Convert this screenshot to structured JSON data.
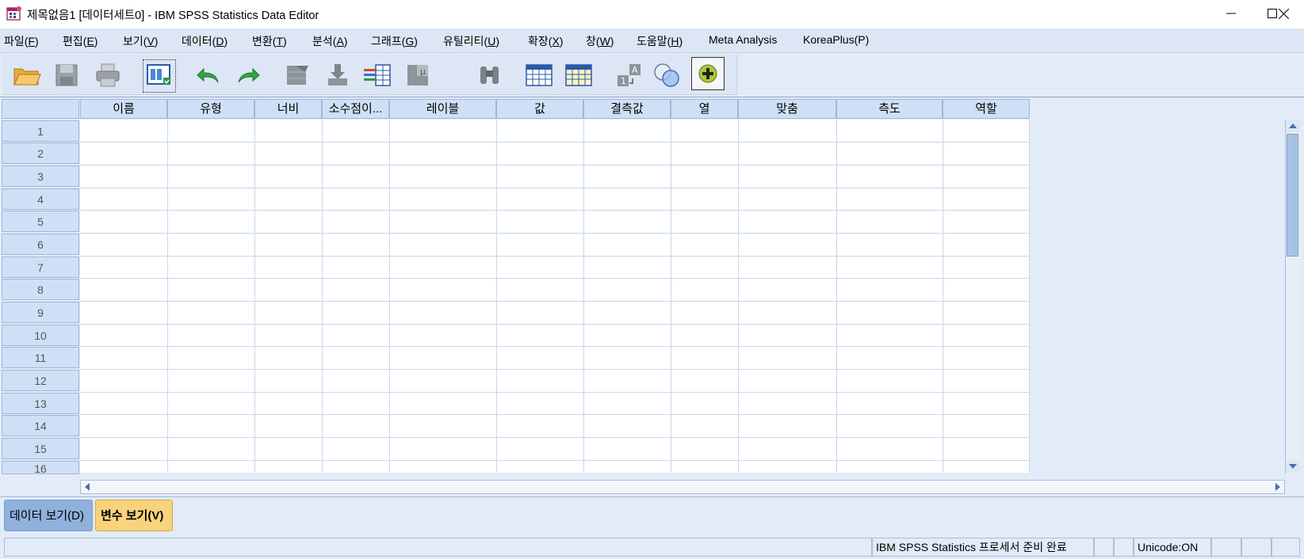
{
  "window": {
    "title": "제목없음1 [데이터세트0] - IBM SPSS Statistics Data Editor"
  },
  "menu": [
    {
      "label": "파일",
      "key": "F"
    },
    {
      "label": "편집",
      "key": "E"
    },
    {
      "label": "보기",
      "key": "V"
    },
    {
      "label": "데이터",
      "key": "D"
    },
    {
      "label": "변환",
      "key": "T"
    },
    {
      "label": "분석",
      "key": "A"
    },
    {
      "label": "그래프",
      "key": "G"
    },
    {
      "label": "유틸리티",
      "key": "U"
    },
    {
      "label": "확장",
      "key": "X"
    },
    {
      "label": "창",
      "key": "W"
    },
    {
      "label": "도움말",
      "key": "H"
    },
    {
      "label": "Meta Analysis",
      "key": ""
    },
    {
      "label": "KoreaPlus(P)",
      "key": ""
    }
  ],
  "toolbar": {
    "icons": [
      "open-folder-icon",
      "save-icon",
      "print-icon",
      "dialog-recall-icon",
      "undo-icon",
      "redo-icon",
      "goto-case-icon",
      "goto-variable-icon",
      "variables-icon",
      "find-icon",
      "binoculars-icon",
      "insert-cases-icon",
      "insert-variable-icon",
      "split-file-icon",
      "weight-cases-icon",
      "select-cases-icon",
      "value-labels-icon",
      "use-sets-icon"
    ]
  },
  "grid": {
    "columns": [
      "이름",
      "유형",
      "너비",
      "소수점이...",
      "레이블",
      "값",
      "결측값",
      "열",
      "맞춤",
      "측도",
      "역할"
    ],
    "rows": [
      "1",
      "2",
      "3",
      "4",
      "5",
      "6",
      "7",
      "8",
      "9",
      "10",
      "11",
      "12",
      "13",
      "14",
      "15",
      "16"
    ]
  },
  "tabs": {
    "data_view": "데이터 보기(D)",
    "variable_view": "변수 보기(V)"
  },
  "status": {
    "processor": "IBM SPSS Statistics 프로세서 준비 완료",
    "unicode": "Unicode:ON"
  }
}
